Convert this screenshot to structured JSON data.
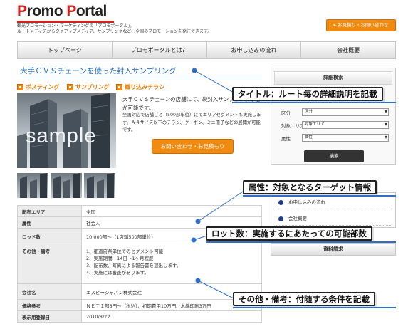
{
  "header": {
    "logo_part1": "P",
    "logo_part2": "romo ",
    "logo_part3": "P",
    "logo_part4": "ortal",
    "tagline_line1": "観光プロモーション・マーケティングの「プロモポータル」。",
    "tagline_line2": "ルートメディアからタイアップメディア、サンプリングなど、全国のプロモーションを発注できます。",
    "top_button": "お見積り・お問い合わせ",
    "brand_color": "#d0201c",
    "accent_color": "#f08a10"
  },
  "nav": {
    "items": [
      "トップページ",
      "プロモポータルとは？",
      "お申し込みの流れ",
      "会社概要"
    ]
  },
  "listing": {
    "title": "大手ＣＶＳチェーンを使った封入サンプリング",
    "categories": [
      "ポスティング",
      "サンプリング",
      "織り込みチラシ"
    ],
    "image_text": "sample",
    "desc_main": "大手ＣＶＳチェーンの店舗にて、袋封入サンプリングなどが可能です。",
    "desc_sub": "全国対応で店舗ごと（500部単位）にてエリアセグメントも実施します。Ａ４サイズ以下のチラシ、クーポン、ミニ冊子などの展開が可能です。",
    "inquiry_button": "お問い合わせ・お見積もり"
  },
  "search": {
    "heading": "詳細検索",
    "fields": [
      {
        "label": "区分",
        "value": "区分"
      },
      {
        "label": "対象エリア",
        "value": "対象エリア"
      },
      {
        "label": "属性",
        "value": "属性"
      }
    ],
    "button": "検索"
  },
  "side_links": {
    "items": [
      "お申し込みの流れ",
      "会社概要"
    ]
  },
  "quote_request": "資料請求",
  "specs": {
    "rows": [
      {
        "key": "配布エリア",
        "value": "全国"
      },
      {
        "key": "属性",
        "value": "社会人"
      },
      {
        "key": "ロッド数",
        "value": "10,000部〜（1店舗500部単位）"
      },
      {
        "key": "その他・備考",
        "lines": [
          "1、都道府県単位でのセグメント可能",
          "2、実施期間　14日〜1ヶ月程度",
          "3、配布数、写真による報告書を提出します。",
          "4、実施には審査があります。"
        ]
      },
      {
        "key": "会社名",
        "value": "エスピージャパン株式会社"
      },
      {
        "key": "価格参考",
        "value": "ＮＥＴ１部8円〜（税込）、初期費用10万円、木綿印刷3万円"
      },
      {
        "key": "表示用登録日",
        "value": "2010/8/22"
      }
    ]
  },
  "annotations": {
    "title": "タイトル：ルート毎の詳細説明を記載",
    "attribute": "属性：対象となるターゲット情報",
    "lot": "ロット数：実施するにあたっての可能部数",
    "other": "その他・備考：付随する条件を記載",
    "line_color": "#2f6fc8"
  }
}
